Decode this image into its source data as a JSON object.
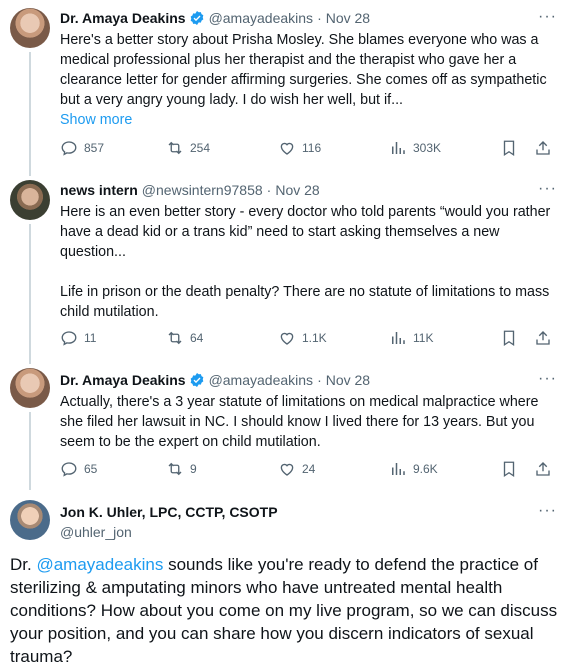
{
  "tweets": [
    {
      "name": "Dr. Amaya Deakins",
      "handle": "@amayadeakins",
      "date": "Nov 28",
      "text": "Here's a better story about Prisha Mosley. She blames everyone who was a medical professional plus her therapist and the therapist who gave her a clearance letter for gender affirming surgeries. She comes off as sympathetic but a very angry young lady. I do wish her well, but if...",
      "show_more": "Show more",
      "replies": "857",
      "retweets": "254",
      "likes": "116",
      "views": "303K"
    },
    {
      "name": "news intern",
      "handle": "@newsintern97858",
      "date": "Nov 28",
      "text": "Here is an even better story - every doctor who told parents “would you rather have a dead kid or a trans kid” need to start asking themselves a new question...",
      "text2": "Life in prison or the death penalty? There are no statute of limitations to mass child mutilation.",
      "replies": "11",
      "retweets": "64",
      "likes": "1.1K",
      "views": "11K"
    },
    {
      "name": "Dr. Amaya Deakins",
      "handle": "@amayadeakins",
      "date": "Nov 28",
      "text": "Actually, there's a 3 year statute of limitations on medical malpractice where she filed her lawsuit in NC. I should know I lived there for 13 years. But you seem to be the expert on child mutilation.",
      "replies": "65",
      "retweets": "9",
      "likes": "24",
      "views": "9.6K"
    }
  ],
  "main_tweet": {
    "name": "Jon K. Uhler, LPC, CCTP, CSOTP",
    "handle": "@uhler_jon",
    "prefix": "Dr. ",
    "mention": "@amayadeakins",
    "text": " sounds like you're ready to defend the practice of sterilizing & amputating minors who have untreated mental health conditions? How about you come on my live program, so we can discuss your position, and you can share how you discern indicators of sexual trauma?"
  },
  "separator": "·",
  "more_glyph": "···",
  "colors": {
    "link": "#1d9bf0",
    "muted": "#536471",
    "verified": "#1d9bf0"
  }
}
